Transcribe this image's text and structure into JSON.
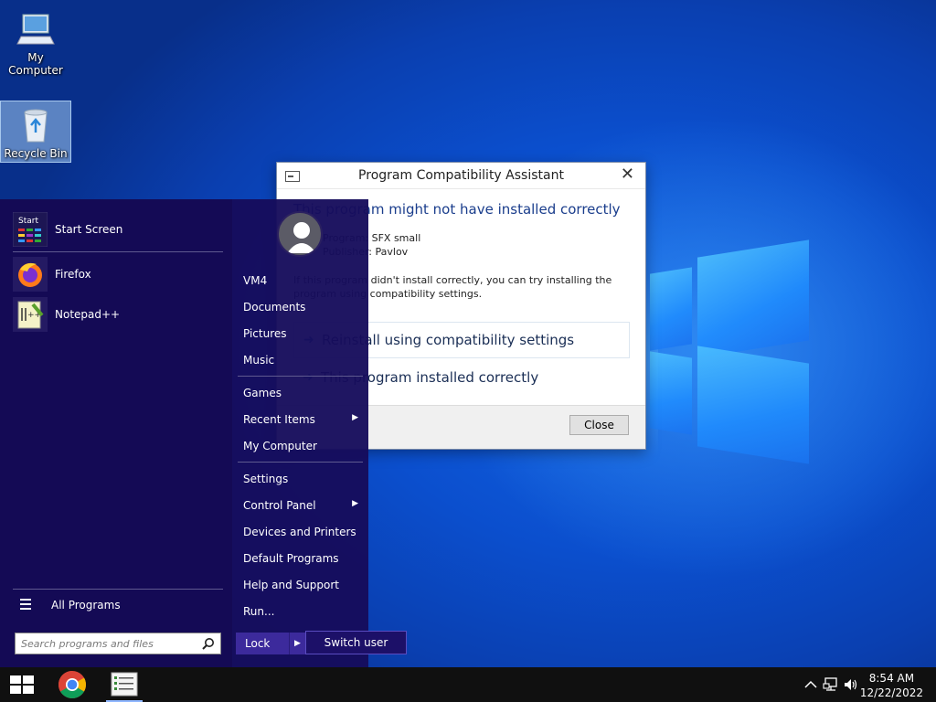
{
  "desktop": {
    "icons": [
      {
        "label": "My Computer",
        "icon": "computer-icon"
      },
      {
        "label": "Recycle Bin",
        "icon": "recycle-bin-icon"
      }
    ]
  },
  "dialog": {
    "title": "Program Compatibility Assistant",
    "heading": "This program might not have installed correctly",
    "program_name": "Program: SFX small",
    "publisher": "Publisher: Pavlov",
    "message": "If this program didn't install correctly, you can try installing the program using compatibility settings.",
    "option_reinstall": "Reinstall using compatibility settings",
    "option_ok": "This program installed correctly",
    "close_label": "Close"
  },
  "start_menu": {
    "apps": [
      {
        "label": "Start Screen",
        "icon": "start-screen-icon"
      },
      {
        "label": "Firefox",
        "icon": "firefox-icon"
      },
      {
        "label": "Notepad++",
        "icon": "notepadpp-icon"
      }
    ],
    "all_programs": "All Programs",
    "search_placeholder": "Search programs and files",
    "start_tile_text": "Start",
    "right_links_1": [
      "VM4",
      "Documents",
      "Pictures",
      "Music"
    ],
    "right_links_2": [
      {
        "label": "Games",
        "submenu": false
      },
      {
        "label": "Recent Items",
        "submenu": true
      },
      {
        "label": "My Computer",
        "submenu": false
      }
    ],
    "right_links_3": [
      {
        "label": "Settings",
        "submenu": false
      },
      {
        "label": "Control Panel",
        "submenu": true
      },
      {
        "label": "Devices and Printers",
        "submenu": false
      },
      {
        "label": "Default Programs",
        "submenu": false
      },
      {
        "label": "Help and Support",
        "submenu": false
      },
      {
        "label": "Run...",
        "submenu": false
      }
    ],
    "lock_label": "Lock",
    "switch_user_label": "Switch user"
  },
  "taskbar": {
    "pinned": [
      "windows-start-icon",
      "chrome-icon",
      "task-list-icon"
    ],
    "time": "8:54 AM",
    "date": "12/22/2022"
  },
  "colors": {
    "start_menu_bg": "#140a55",
    "dialog_heading": "#1a3d8c",
    "taskbar": "#101010"
  }
}
